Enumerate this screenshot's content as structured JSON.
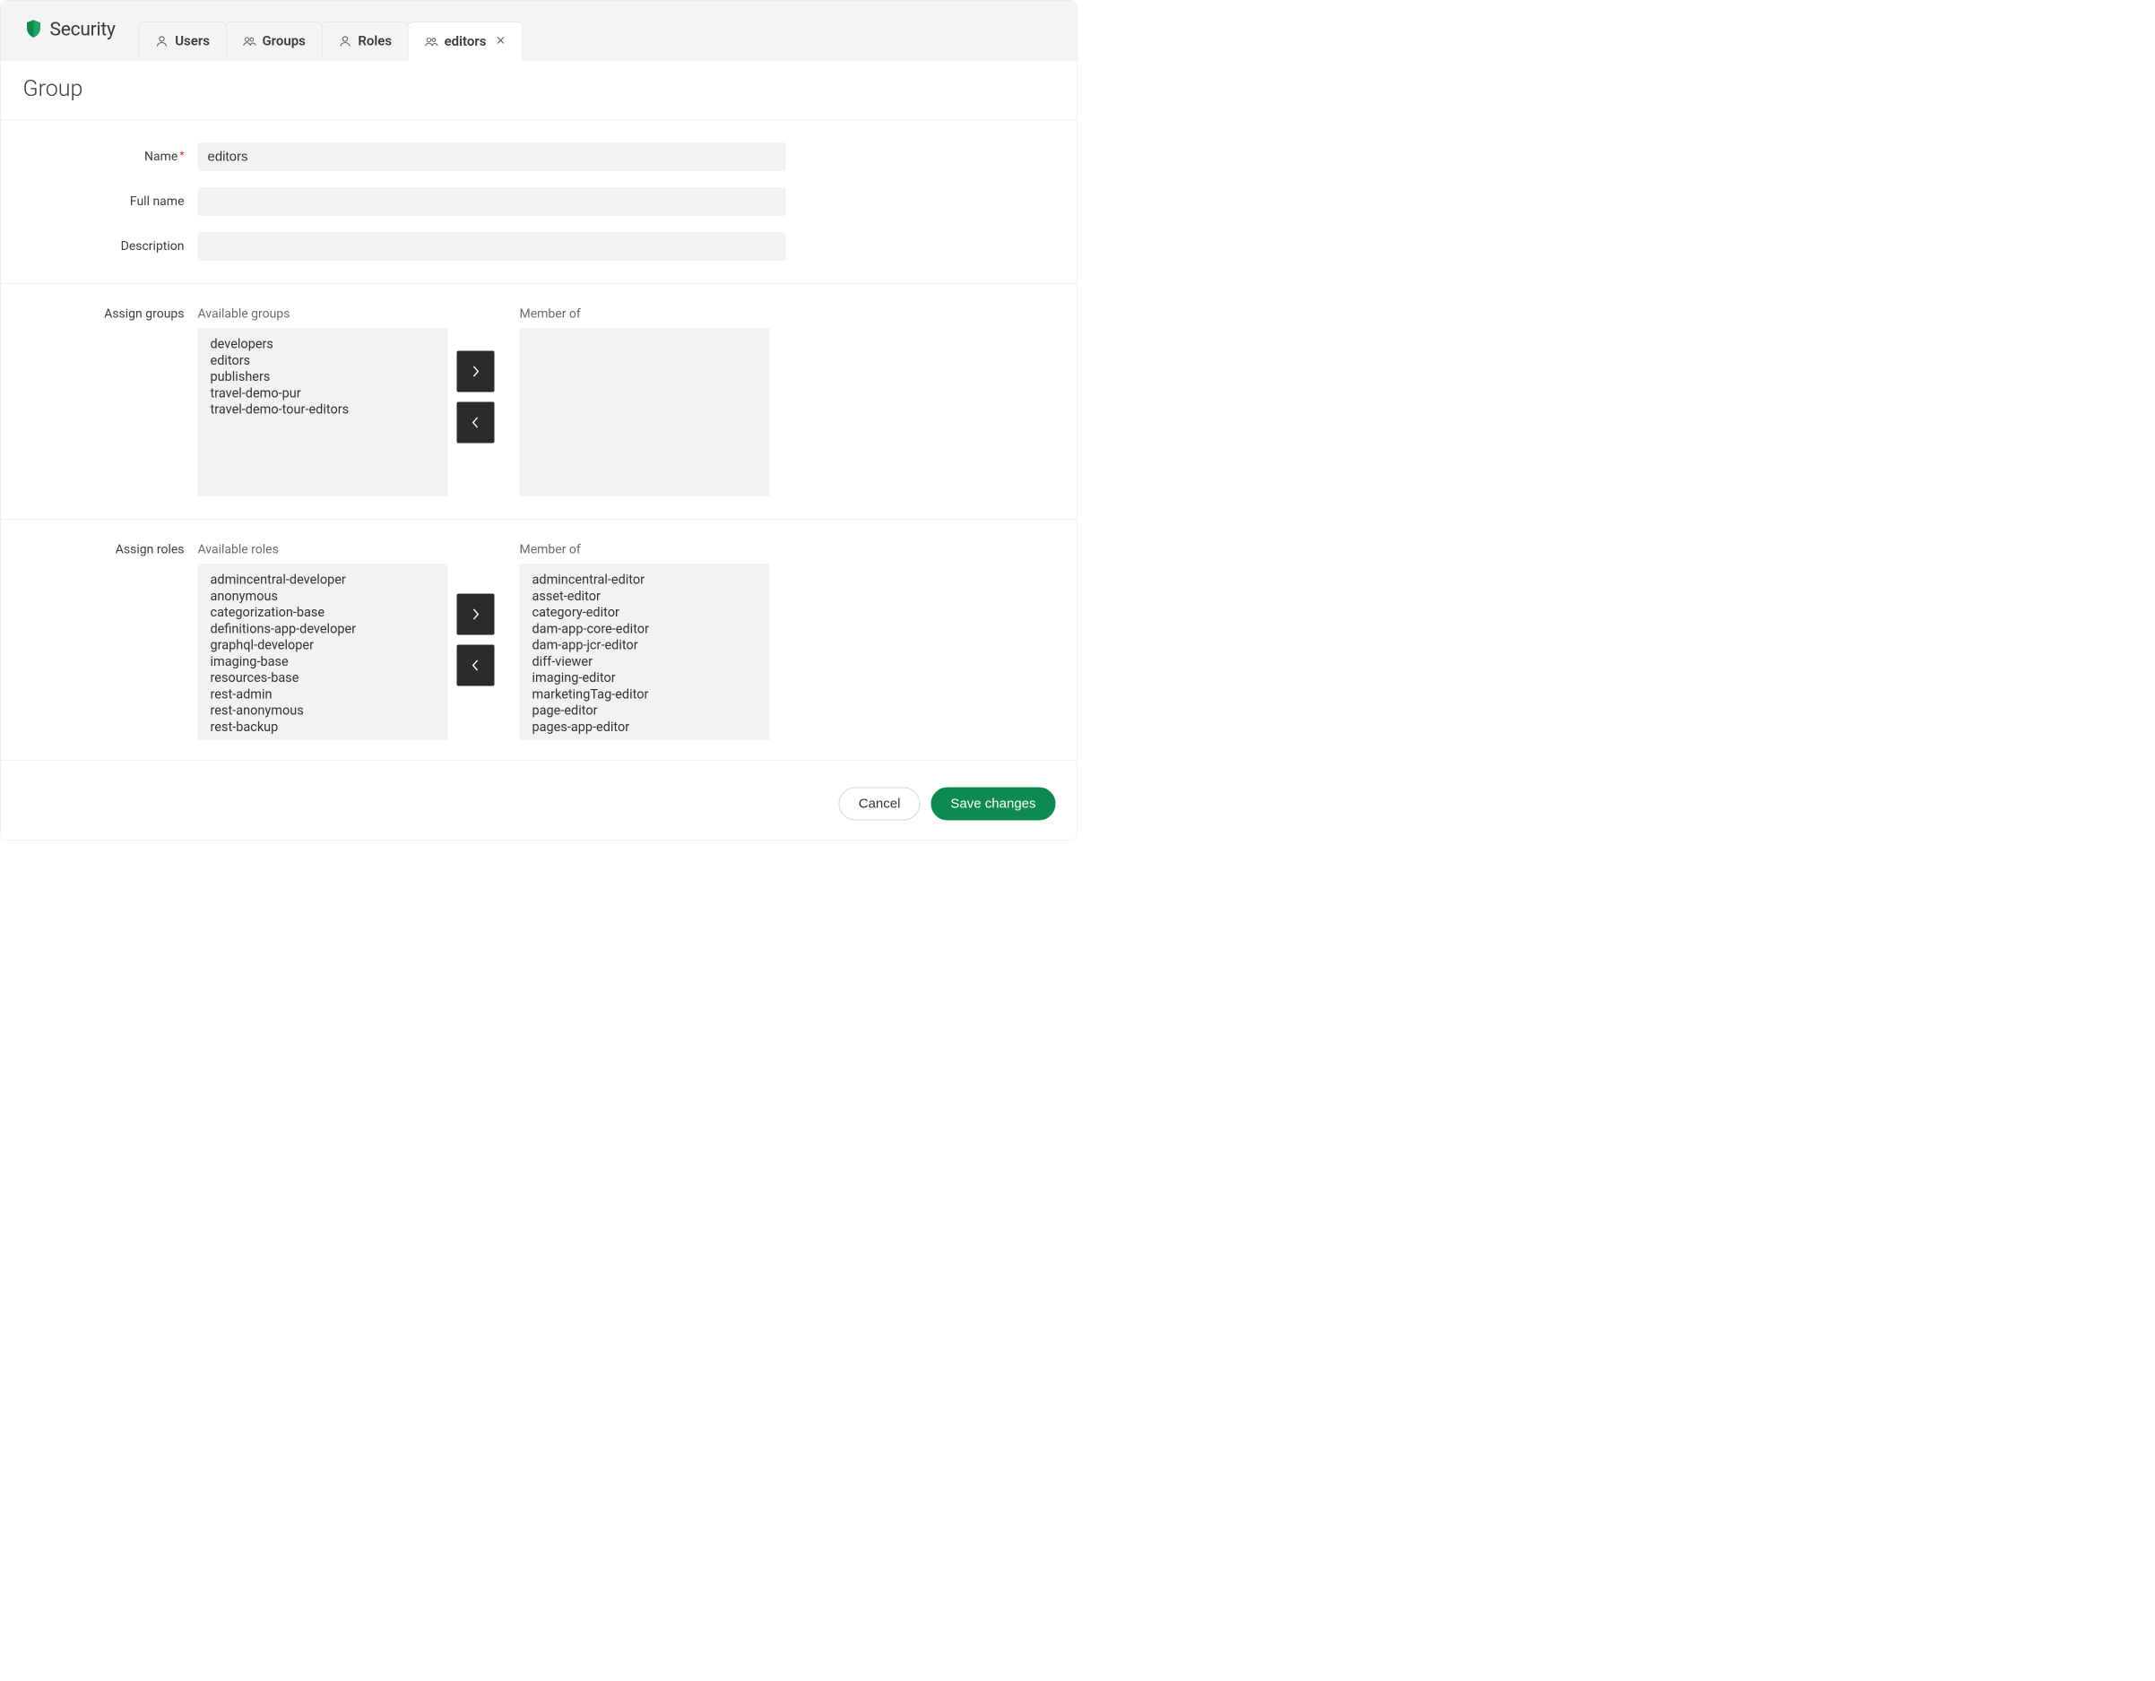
{
  "app": {
    "title": "Security"
  },
  "tabs": {
    "users": {
      "label": "Users"
    },
    "groups": {
      "label": "Groups"
    },
    "roles": {
      "label": "Roles"
    },
    "editors": {
      "label": "editors"
    }
  },
  "page": {
    "title": "Group"
  },
  "form": {
    "name": {
      "label": "Name",
      "value": "editors"
    },
    "fullName": {
      "label": "Full name",
      "value": ""
    },
    "description": {
      "label": "Description",
      "value": ""
    }
  },
  "assignGroups": {
    "label": "Assign groups",
    "availableLabel": "Available groups",
    "memberLabel": "Member of",
    "available": [
      "developers",
      "editors",
      "publishers",
      "travel-demo-pur",
      "travel-demo-tour-editors"
    ],
    "member": []
  },
  "assignRoles": {
    "label": "Assign roles",
    "availableLabel": "Available roles",
    "memberLabel": "Member of",
    "available": [
      "admincentral-developer",
      "anonymous",
      "categorization-base",
      "definitions-app-developer",
      "graphql-developer",
      "imaging-base",
      "resources-base",
      "rest-admin",
      "rest-anonymous",
      "rest-backup"
    ],
    "member": [
      "admincentral-editor",
      "asset-editor",
      "category-editor",
      "dam-app-core-editor",
      "dam-app-jcr-editor",
      "diff-viewer",
      "imaging-editor",
      "marketingTag-editor",
      "page-editor",
      "pages-app-editor"
    ]
  },
  "buttons": {
    "cancel": "Cancel",
    "save": "Save changes"
  }
}
